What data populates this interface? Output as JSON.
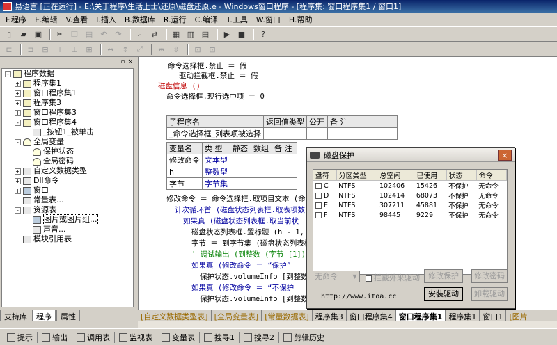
{
  "window": {
    "title": "易语言 [正在运行] - E:\\关于程序\\生活上士\\还原\\磁盘还原.e - Windows窗口程序 - [程序集: 窗口程序集1 / 窗口1]"
  },
  "menu": [
    "F.程序",
    "E.编辑",
    "V.查看",
    "I.插入",
    "B.数据库",
    "R.运行",
    "C.编译",
    "T.工具",
    "W.窗口",
    "H.帮助"
  ],
  "left_panel": {
    "tree": [
      {
        "label": "程序数据",
        "level": 0,
        "pm": "-",
        "icon": "book"
      },
      {
        "label": "程序集1",
        "level": 1,
        "pm": "+",
        "icon": "book"
      },
      {
        "label": "窗口程序集1",
        "level": 1,
        "pm": "+",
        "icon": "book"
      },
      {
        "label": "程序集3",
        "level": 1,
        "pm": "+",
        "icon": "book"
      },
      {
        "label": "窗口程序集3",
        "level": 1,
        "pm": "+",
        "icon": "book"
      },
      {
        "label": "窗口程序集4",
        "level": 1,
        "pm": "-",
        "icon": "book"
      },
      {
        "label": "_按钮1_被单击",
        "level": 2,
        "pm": "",
        "icon": "sub"
      },
      {
        "label": "全局变量",
        "level": 1,
        "pm": "-",
        "icon": "db"
      },
      {
        "label": "保护状态",
        "level": 2,
        "pm": "",
        "icon": "db"
      },
      {
        "label": "全局密码",
        "level": 2,
        "pm": "",
        "icon": "db"
      },
      {
        "label": "自定义数据类型",
        "level": 1,
        "pm": "+",
        "icon": "sub"
      },
      {
        "label": "Dll命令",
        "level": 1,
        "pm": "+",
        "icon": "sub"
      },
      {
        "label": "窗口",
        "level": 1,
        "pm": "+",
        "icon": "win"
      },
      {
        "label": "常量表...",
        "level": 1,
        "pm": "",
        "icon": "sub"
      },
      {
        "label": "资源表",
        "level": 1,
        "pm": "-",
        "icon": "sub"
      },
      {
        "label": "图片或图片组...",
        "level": 2,
        "pm": "",
        "icon": "win",
        "selected": true
      },
      {
        "label": "声音...",
        "level": 2,
        "pm": "",
        "icon": "sub"
      },
      {
        "label": "模块引用表",
        "level": 1,
        "pm": "",
        "icon": "sub"
      }
    ],
    "tabs": [
      "支持库",
      "程序",
      "属性"
    ]
  },
  "editor": {
    "lines_top": [
      {
        "text": "命令选择框.禁止 ＝ 假",
        "cls": ""
      },
      {
        "text": "驱动拦截框.禁止 ＝ 假",
        "cls": ""
      },
      {
        "text": "磁盘信息 ()",
        "cls": "red"
      },
      {
        "text": "命令选择框.现行选中项 ＝ 0",
        "cls": ""
      }
    ],
    "sub_table": {
      "header": [
        "子程序名",
        "返回值类型",
        "公开",
        "备 注"
      ],
      "row": [
        "_命令选择框_列表项被选择",
        "",
        "",
        ""
      ]
    },
    "var_table": {
      "header": [
        "变量名",
        "类 型",
        "静态",
        "数组",
        "备 注"
      ],
      "rows": [
        [
          "修改命令",
          "文本型",
          "",
          "",
          ""
        ],
        [
          "h",
          "整数型",
          "",
          "",
          ""
        ],
        [
          "字节",
          "字节集",
          "",
          "",
          ""
        ]
      ]
    },
    "lines_bottom": [
      {
        "text": "修改命令 ＝ 命令选择框.取项目文本 (命令",
        "indent": 0,
        "cls": ""
      },
      {
        "text": "计次循环首 (磁盘状态列表框.取表项数",
        "indent": 1,
        "cls": "kw"
      },
      {
        "text": "如果真 (磁盘状态列表框.取当前状",
        "indent": 2,
        "cls": "kw"
      },
      {
        "text": "磁盘状态列表框.置标题 (h - 1,",
        "indent": 3,
        "cls": ""
      },
      {
        "text": "字节 ＝ 到字节集 (磁盘状态列表框",
        "indent": 3,
        "cls": ""
      },
      {
        "text": "' 调试输出 (到整数 (字节 [1]))",
        "indent": 3,
        "cls": "grn"
      },
      {
        "text": "如果真 (修改命令 ＝ “保护”",
        "indent": 3,
        "cls": "kw"
      },
      {
        "text": "保护状态.volumeInfo [到整数",
        "indent": 4,
        "cls": ""
      },
      {
        "text": "如果真 (修改命令 ＝ “不保护",
        "indent": 3,
        "cls": "kw"
      },
      {
        "text": "保护状态.volumeInfo [到整数",
        "indent": 4,
        "cls": ""
      }
    ],
    "tabs": [
      "[自定义数据类型表]",
      "[全局变量表]",
      "[常量数据表]",
      "程序集3",
      "窗口程序集4",
      "窗口程序集1",
      "程序集1",
      "窗口1",
      "[图片"
    ]
  },
  "dialog": {
    "title": "磁盘保护",
    "close": "×",
    "columns": [
      "盘符",
      "分区类型",
      "总空间",
      "已使用",
      "状态",
      "命令"
    ],
    "rows": [
      [
        "C",
        "NTFS",
        "102406",
        "15426",
        "不保护",
        "无命令"
      ],
      [
        "D",
        "NTFS",
        "102414",
        "68073",
        "不保护",
        "无命令"
      ],
      [
        "E",
        "NTFS",
        "307211",
        "45881",
        "不保护",
        "无命令"
      ],
      [
        "F",
        "NTFS",
        "98445",
        "9229",
        "不保护",
        "无命令"
      ]
    ],
    "select_value": "无命令",
    "checkbox_label": "拦截外来驱动",
    "buttons": {
      "modify_protect": "修改保护",
      "modify_password": "修改密码",
      "install_driver": "安装驱动",
      "uninstall_driver": "卸载驱动"
    },
    "url": "http://www.itoa.cc"
  },
  "bottom_bar": [
    "提示",
    "输出",
    "调用表",
    "监视表",
    "变量表",
    "搜寻1",
    "搜寻2",
    "剪辑历史"
  ]
}
